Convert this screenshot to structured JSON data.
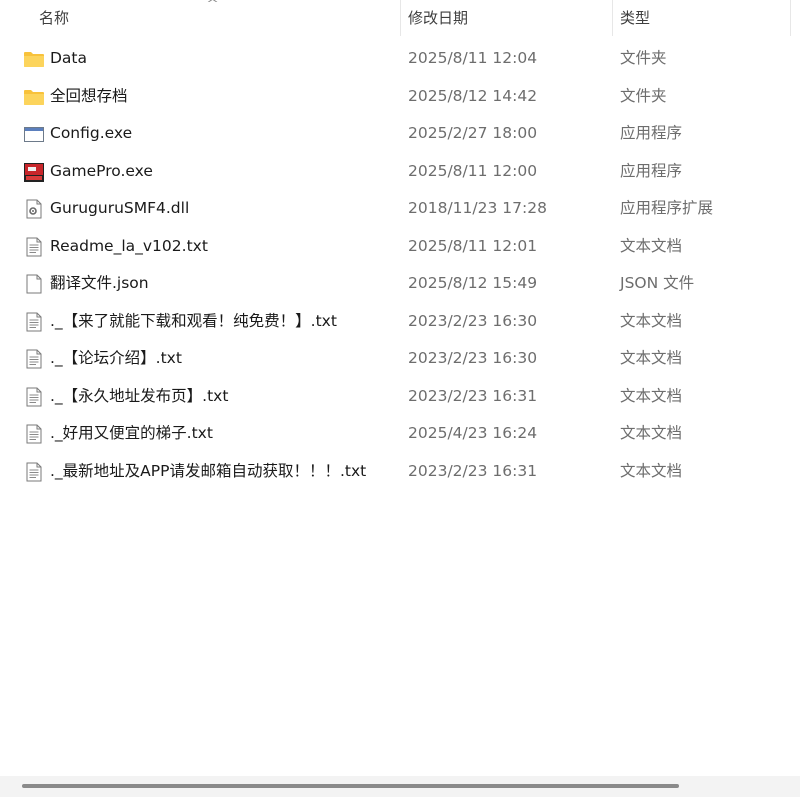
{
  "header": {
    "name": "名称",
    "date": "修改日期",
    "type": "类型"
  },
  "files": [
    {
      "icon": "folder-icon",
      "name": "Data",
      "date": "2025/8/11 12:04",
      "type": "文件夹"
    },
    {
      "icon": "folder-icon",
      "name": "全回想存档",
      "date": "2025/8/12 14:42",
      "type": "文件夹"
    },
    {
      "icon": "window-app-icon",
      "name": "Config.exe",
      "date": "2025/2/27 18:00",
      "type": "应用程序"
    },
    {
      "icon": "game-app-icon",
      "name": "GamePro.exe",
      "date": "2025/8/11 12:00",
      "type": "应用程序"
    },
    {
      "icon": "dll-gear-icon",
      "name": "GuruguruSMF4.dll",
      "date": "2018/11/23 17:28",
      "type": "应用程序扩展"
    },
    {
      "icon": "text-document-icon",
      "name": "Readme_la_v102.txt",
      "date": "2025/8/11 12:01",
      "type": "文本文档"
    },
    {
      "icon": "blank-document-icon",
      "name": "翻译文件.json",
      "date": "2025/8/12 15:49",
      "type": "JSON 文件"
    },
    {
      "icon": "text-document-icon",
      "name": "._【来了就能下载和观看！纯免费！】.txt",
      "date": "2023/2/23 16:30",
      "type": "文本文档"
    },
    {
      "icon": "text-document-icon",
      "name": "._【论坛介绍】.txt",
      "date": "2023/2/23 16:30",
      "type": "文本文档"
    },
    {
      "icon": "text-document-icon",
      "name": "._【永久地址发布页】.txt",
      "date": "2023/2/23 16:31",
      "type": "文本文档"
    },
    {
      "icon": "text-document-icon",
      "name": "._好用又便宜的梯子.txt",
      "date": "2025/4/23 16:24",
      "type": "文本文档"
    },
    {
      "icon": "text-document-icon",
      "name": "._最新地址及APP请发邮箱自动获取！！！.txt",
      "date": "2023/2/23 16:31",
      "type": "文本文档"
    }
  ],
  "colors": {
    "folder": "#F8C23B",
    "date_text": "#6D6D6D",
    "scroll_thumb": "#8A8A8A"
  }
}
